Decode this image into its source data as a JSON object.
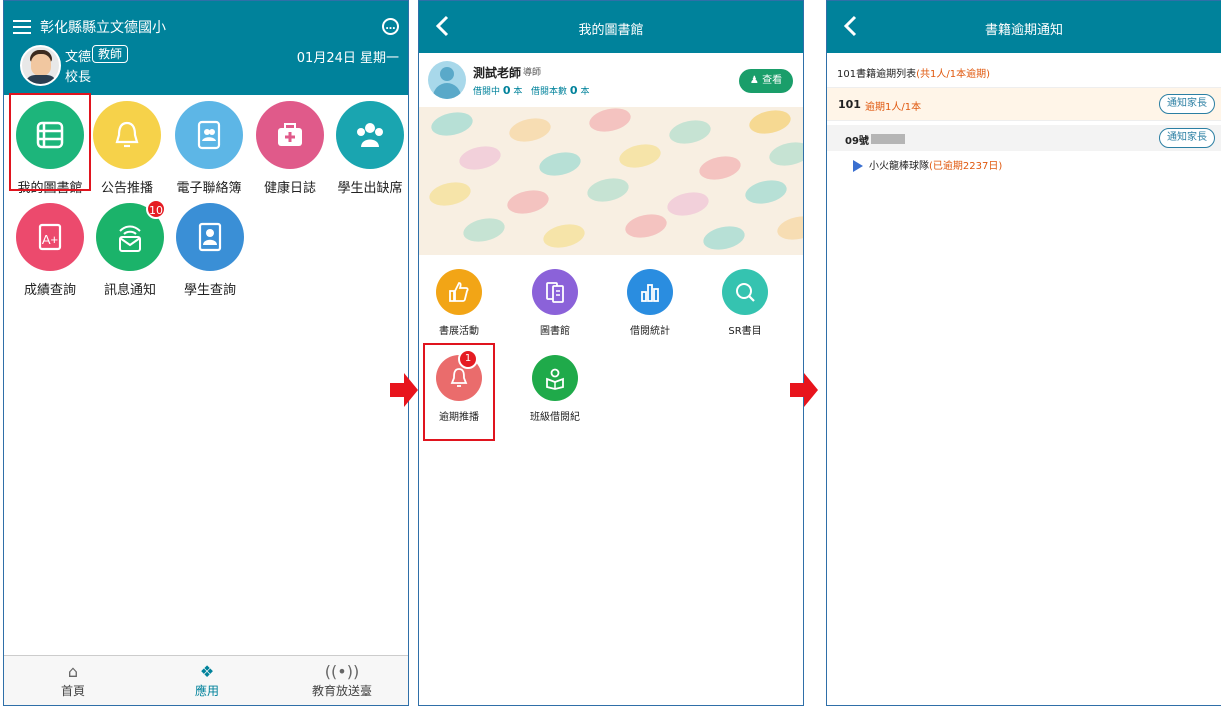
{
  "panel1": {
    "school_name": "彰化縣縣立文德國小",
    "user": {
      "name": "文德",
      "role_badge": "教師",
      "title": "校長"
    },
    "date": "01月24日 星期一",
    "apps": [
      {
        "label": "我的圖書館",
        "icon": "library-icon",
        "color": "#1db57b"
      },
      {
        "label": "公告推播",
        "icon": "bell-icon",
        "color": "#f6d24a"
      },
      {
        "label": "電子聯絡簿",
        "icon": "contact-book-icon",
        "color": "#5db6e6"
      },
      {
        "label": "健康日誌",
        "icon": "medical-kit-icon",
        "color": "#e05a8a"
      },
      {
        "label": "學生出缺席",
        "icon": "attendance-icon",
        "color": "#1aa5b0"
      },
      {
        "label": "成績查詢",
        "icon": "grade-icon",
        "color": "#ec4a6d"
      },
      {
        "label": "訊息通知",
        "icon": "message-icon",
        "color": "#1bb36a",
        "badge": "10"
      },
      {
        "label": "學生查詢",
        "icon": "student-search-icon",
        "color": "#3a8fd6"
      }
    ],
    "tabs": [
      {
        "label": "首頁",
        "icon": "home-icon"
      },
      {
        "label": "應用",
        "icon": "apps-icon"
      },
      {
        "label": "教育放送臺",
        "icon": "broadcast-icon"
      }
    ]
  },
  "panel2": {
    "title": "我的圖書館",
    "profile": {
      "name": "測試老師",
      "role": "導師",
      "borrowing_label": "借閱中",
      "borrowing_count": "0",
      "unit": "本",
      "total_label": "借閱本數",
      "total_count": "0",
      "view_button": "查看"
    },
    "functions": [
      {
        "label": "書展活動",
        "icon": "thumbs-up-icon",
        "color": "#f2a516"
      },
      {
        "label": "圖書館",
        "icon": "books-icon",
        "color": "#8b62d9"
      },
      {
        "label": "借閱統計",
        "icon": "bar-chart-icon",
        "color": "#2a8de0"
      },
      {
        "label": "SR書目",
        "icon": "magnifier-icon",
        "color": "#35c3b0"
      },
      {
        "label": "逾期推播",
        "icon": "bell-icon",
        "color": "#ea6c6c",
        "badge": "1"
      },
      {
        "label": "班級借閱紀",
        "icon": "reader-icon",
        "color": "#1faa4a"
      }
    ]
  },
  "panel3": {
    "title": "書籍逾期通知",
    "list_title_prefix": "101書籍逾期列表",
    "list_title_suffix": "(共1人/1本逾期)",
    "class_row": {
      "class": "101",
      "overdue": "逾期1人/1本",
      "button": "通知家長"
    },
    "student_row": {
      "seat": "09號",
      "button": "通知家長"
    },
    "book": {
      "title": "小火龍棒球隊",
      "overdue": "(已逾期2237日)"
    }
  },
  "colors": {
    "header": "#00829b",
    "highlight": "#e0141e",
    "arrow": "#e8141c",
    "overdue_text": "#e0580e"
  }
}
